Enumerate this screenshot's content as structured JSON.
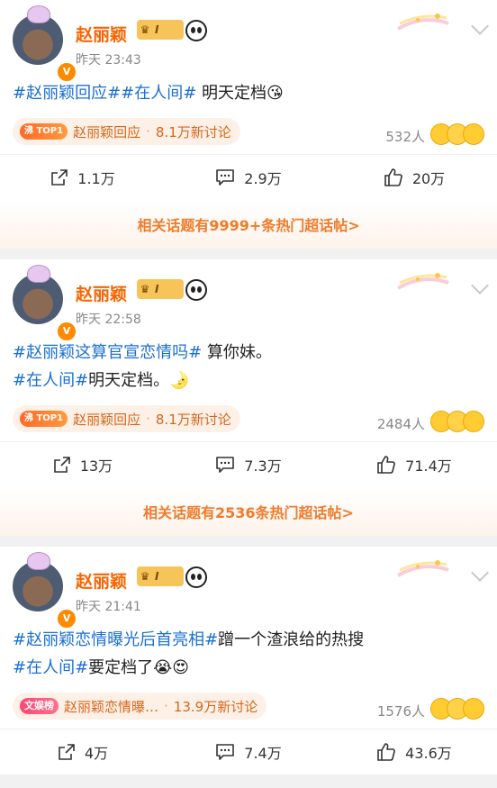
{
  "posts": [
    {
      "author": "赵丽颖",
      "member_level": "I",
      "time": "昨天 23:43",
      "lines": [
        {
          "segments": [
            {
              "t": "#赵丽颖回应##在人间#",
              "tag": true
            },
            {
              "t": " 明天定档😘",
              "tag": false
            }
          ]
        }
      ],
      "hot": {
        "badge": "TOP1",
        "badge_prefix": "沸",
        "title": "赵丽颖回应",
        "count": "8.1万新讨论"
      },
      "people": "532人",
      "actions": {
        "share": "1.1万",
        "comment": "2.9万",
        "like": "20万"
      },
      "related": "相关话题有9999+条热门超话帖>"
    },
    {
      "author": "赵丽颖",
      "member_level": "I",
      "time": "昨天 22:58",
      "lines": [
        {
          "segments": [
            {
              "t": "#赵丽颖这算官宣恋情吗#",
              "tag": true
            },
            {
              "t": " 算你妹。",
              "tag": false
            }
          ]
        },
        {
          "segments": [
            {
              "t": "#在人间#",
              "tag": true
            },
            {
              "t": "明天定档。🌛",
              "tag": false
            }
          ]
        }
      ],
      "hot": {
        "badge": "TOP1",
        "badge_prefix": "沸",
        "title": "赵丽颖回应",
        "count": "8.1万新讨论"
      },
      "people": "2484人",
      "actions": {
        "share": "13万",
        "comment": "7.3万",
        "like": "71.4万"
      },
      "related": "相关话题有2536条热门超话帖>"
    },
    {
      "author": "赵丽颖",
      "member_level": "I",
      "time": "昨天 21:41",
      "lines": [
        {
          "segments": [
            {
              "t": "#赵丽颖恋情曝光后首亮相#",
              "tag": true
            },
            {
              "t": "蹭一个渣浪给的热搜",
              "tag": false
            }
          ]
        },
        {
          "segments": [
            {
              "t": "#在人间#",
              "tag": true
            },
            {
              "t": "要定档了😭😍",
              "tag": false
            }
          ]
        }
      ],
      "hot": {
        "badge": "文娱榜",
        "badge_prefix": "",
        "title": "赵丽颖恋情曝…",
        "count": "13.9万新讨论"
      },
      "people": "1576人",
      "actions": {
        "share": "4万",
        "comment": "7.4万",
        "like": "43.6万"
      },
      "related": ""
    }
  ],
  "colors": {
    "accent": "#f86501",
    "tag": "#1a6fd1",
    "hot": "#d9651a"
  }
}
